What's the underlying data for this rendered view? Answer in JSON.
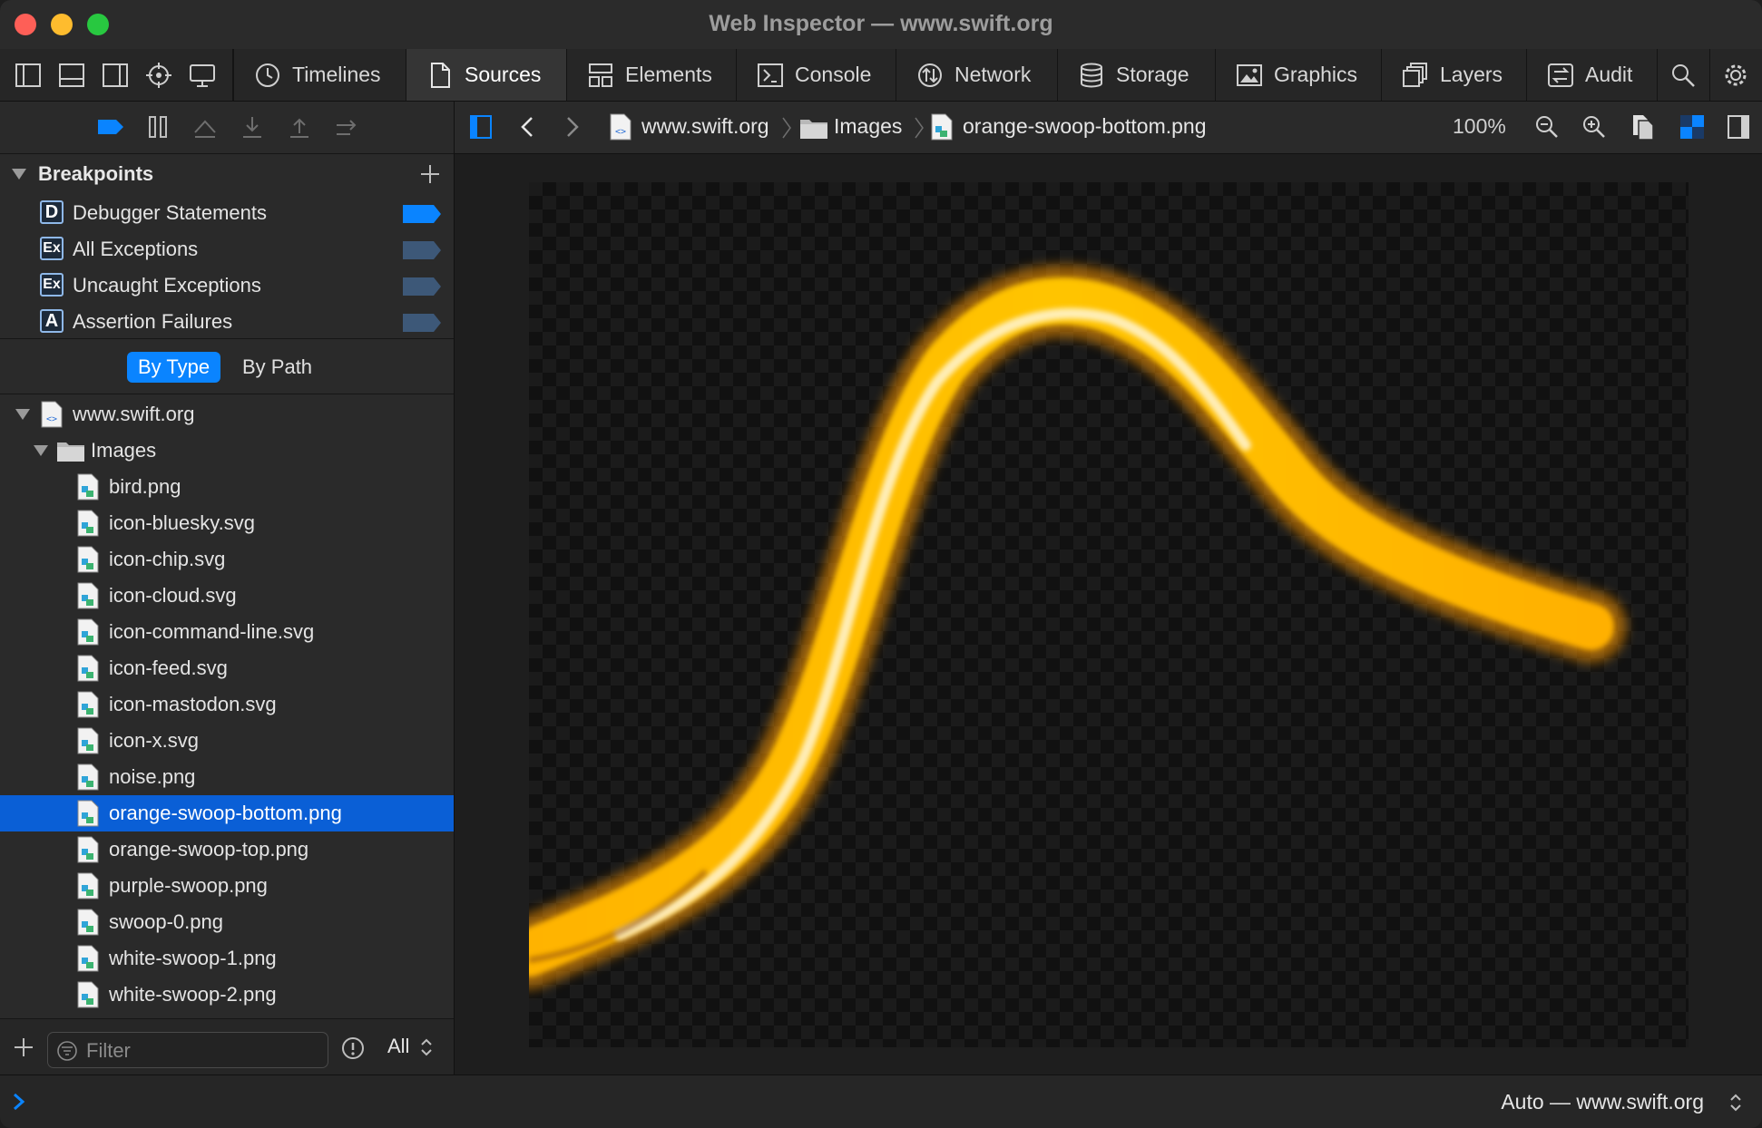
{
  "window": {
    "title": "Web Inspector — www.swift.org"
  },
  "tabs": [
    {
      "label": "Timelines",
      "icon": "clock-icon"
    },
    {
      "label": "Sources",
      "icon": "document-icon",
      "active": true
    },
    {
      "label": "Elements",
      "icon": "elements-icon"
    },
    {
      "label": "Console",
      "icon": "console-icon"
    },
    {
      "label": "Network",
      "icon": "network-icon"
    },
    {
      "label": "Storage",
      "icon": "storage-icon"
    },
    {
      "label": "Graphics",
      "icon": "image-icon"
    },
    {
      "label": "Layers",
      "icon": "layers-icon"
    },
    {
      "label": "Audit",
      "icon": "audit-icon"
    }
  ],
  "breakpoints": {
    "header": "Breakpoints",
    "items": [
      {
        "badge": "D",
        "label": "Debugger Statements",
        "enabled": true
      },
      {
        "badge": "Ex",
        "label": "All Exceptions",
        "enabled": false
      },
      {
        "badge": "Ex",
        "label": "Uncaught Exceptions",
        "enabled": false
      },
      {
        "badge": "A",
        "label": "Assertion Failures",
        "enabled": false
      }
    ]
  },
  "scope": {
    "by_type": "By Type",
    "by_path": "By Path",
    "selected": "By Type"
  },
  "tree": {
    "origin": "www.swift.org",
    "folder": "Images",
    "files": [
      "bird.png",
      "icon-bluesky.svg",
      "icon-chip.svg",
      "icon-cloud.svg",
      "icon-command-line.svg",
      "icon-feed.svg",
      "icon-mastodon.svg",
      "icon-x.svg",
      "noise.png",
      "orange-swoop-bottom.png",
      "orange-swoop-top.png",
      "purple-swoop.png",
      "swoop-0.png",
      "white-swoop-1.png",
      "white-swoop-2.png"
    ],
    "selected": "orange-swoop-bottom.png"
  },
  "footer": {
    "filter_placeholder": "Filter",
    "scope": "All"
  },
  "breadcrumb": {
    "origin": "www.swift.org",
    "folder": "Images",
    "file": "orange-swoop-bottom.png"
  },
  "zoom": "100%",
  "status": {
    "target": "Auto — www.swift.org"
  },
  "colors": {
    "accent": "#0a84ff",
    "selection": "#0a5fd6",
    "swoop": "#ffb800"
  }
}
